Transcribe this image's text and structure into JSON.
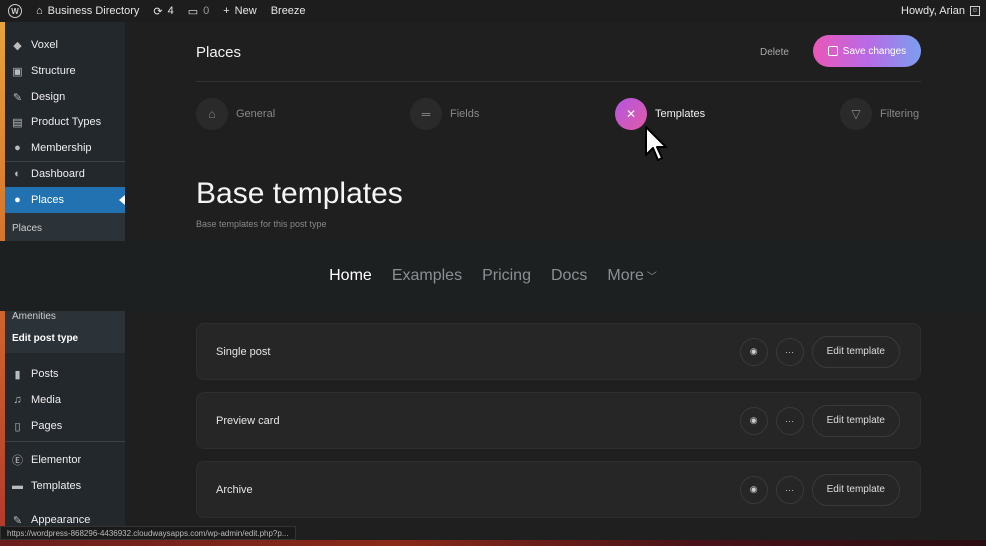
{
  "admin_bar": {
    "site_name": "Business Directory",
    "updates_count": "4",
    "comments_count": "0",
    "new_label": "New",
    "plugin_label": "Breeze",
    "greeting": "Howdy, Arian"
  },
  "sidebar": {
    "top_items": [
      {
        "label": "Voxel",
        "icon": "voxel-icon"
      },
      {
        "label": "Structure",
        "icon": "cube-icon"
      },
      {
        "label": "Design",
        "icon": "brush-icon"
      },
      {
        "label": "Product Types",
        "icon": "bag-icon"
      },
      {
        "label": "Membership",
        "icon": "person-icon"
      },
      {
        "label": "Dashboard",
        "icon": "dashboard-icon"
      },
      {
        "label": "Places",
        "icon": "pin-icon"
      }
    ],
    "submenu_top": [
      "Places"
    ],
    "submenu_bottom": [
      "Amenities",
      "Edit post type"
    ],
    "bottom_items": [
      {
        "label": "Posts",
        "icon": "pushpin-icon"
      },
      {
        "label": "Media",
        "icon": "media-icon"
      },
      {
        "label": "Pages",
        "icon": "pages-icon"
      },
      {
        "label": "Elementor",
        "icon": "elementor-icon"
      },
      {
        "label": "Templates",
        "icon": "folder-icon"
      },
      {
        "label": "Appearance",
        "icon": "brush-icon"
      }
    ]
  },
  "header": {
    "title": "Places",
    "delete_label": "Delete",
    "save_label": "Save changes"
  },
  "tabs": [
    {
      "label": "General",
      "icon": "home-icon",
      "active": false
    },
    {
      "label": "Fields",
      "icon": "lines-icon",
      "active": false
    },
    {
      "label": "Templates",
      "icon": "tools-icon",
      "active": true
    },
    {
      "label": "Filtering",
      "icon": "filter-icon",
      "active": false
    }
  ],
  "section": {
    "title": "Base templates",
    "subtitle": "Base templates for this post type"
  },
  "overlay_nav": {
    "links": [
      "Home",
      "Examples",
      "Pricing",
      "Docs",
      "More"
    ]
  },
  "templates": [
    {
      "label": "Single post",
      "edit_label": "Edit template"
    },
    {
      "label": "Preview card",
      "edit_label": "Edit template"
    },
    {
      "label": "Archive",
      "edit_label": "Edit template"
    }
  ],
  "status_url": "https://wordpress-868296-4436932.cloudwaysapps.com/wp-admin/edit.php?p..."
}
